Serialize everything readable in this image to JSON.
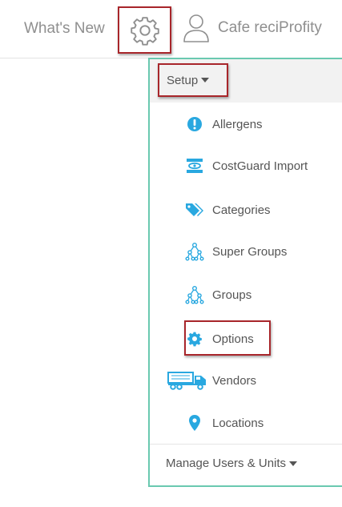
{
  "header": {
    "whats_new": "What's New",
    "user_name": "Cafe reciProfity"
  },
  "menu": {
    "setup_label": "Setup",
    "items": [
      {
        "label": "Allergens",
        "icon": "exclamation-circle-icon"
      },
      {
        "label": "CostGuard Import",
        "icon": "costguard-icon"
      },
      {
        "label": "Categories",
        "icon": "tags-icon"
      },
      {
        "label": "Super Groups",
        "icon": "hierarchy-icon"
      },
      {
        "label": "Groups",
        "icon": "hierarchy-icon"
      },
      {
        "label": "Options",
        "icon": "gear-icon"
      },
      {
        "label": "Vendors",
        "icon": "truck-icon"
      },
      {
        "label": "Locations",
        "icon": "map-pin-icon"
      }
    ],
    "manage_label": "Manage Users & Units"
  },
  "colors": {
    "accent": "#29a8e0",
    "highlight_border": "#a8262b",
    "menu_border": "#6ac9b0",
    "text": "#555555",
    "header_text": "#8f8f8f"
  }
}
